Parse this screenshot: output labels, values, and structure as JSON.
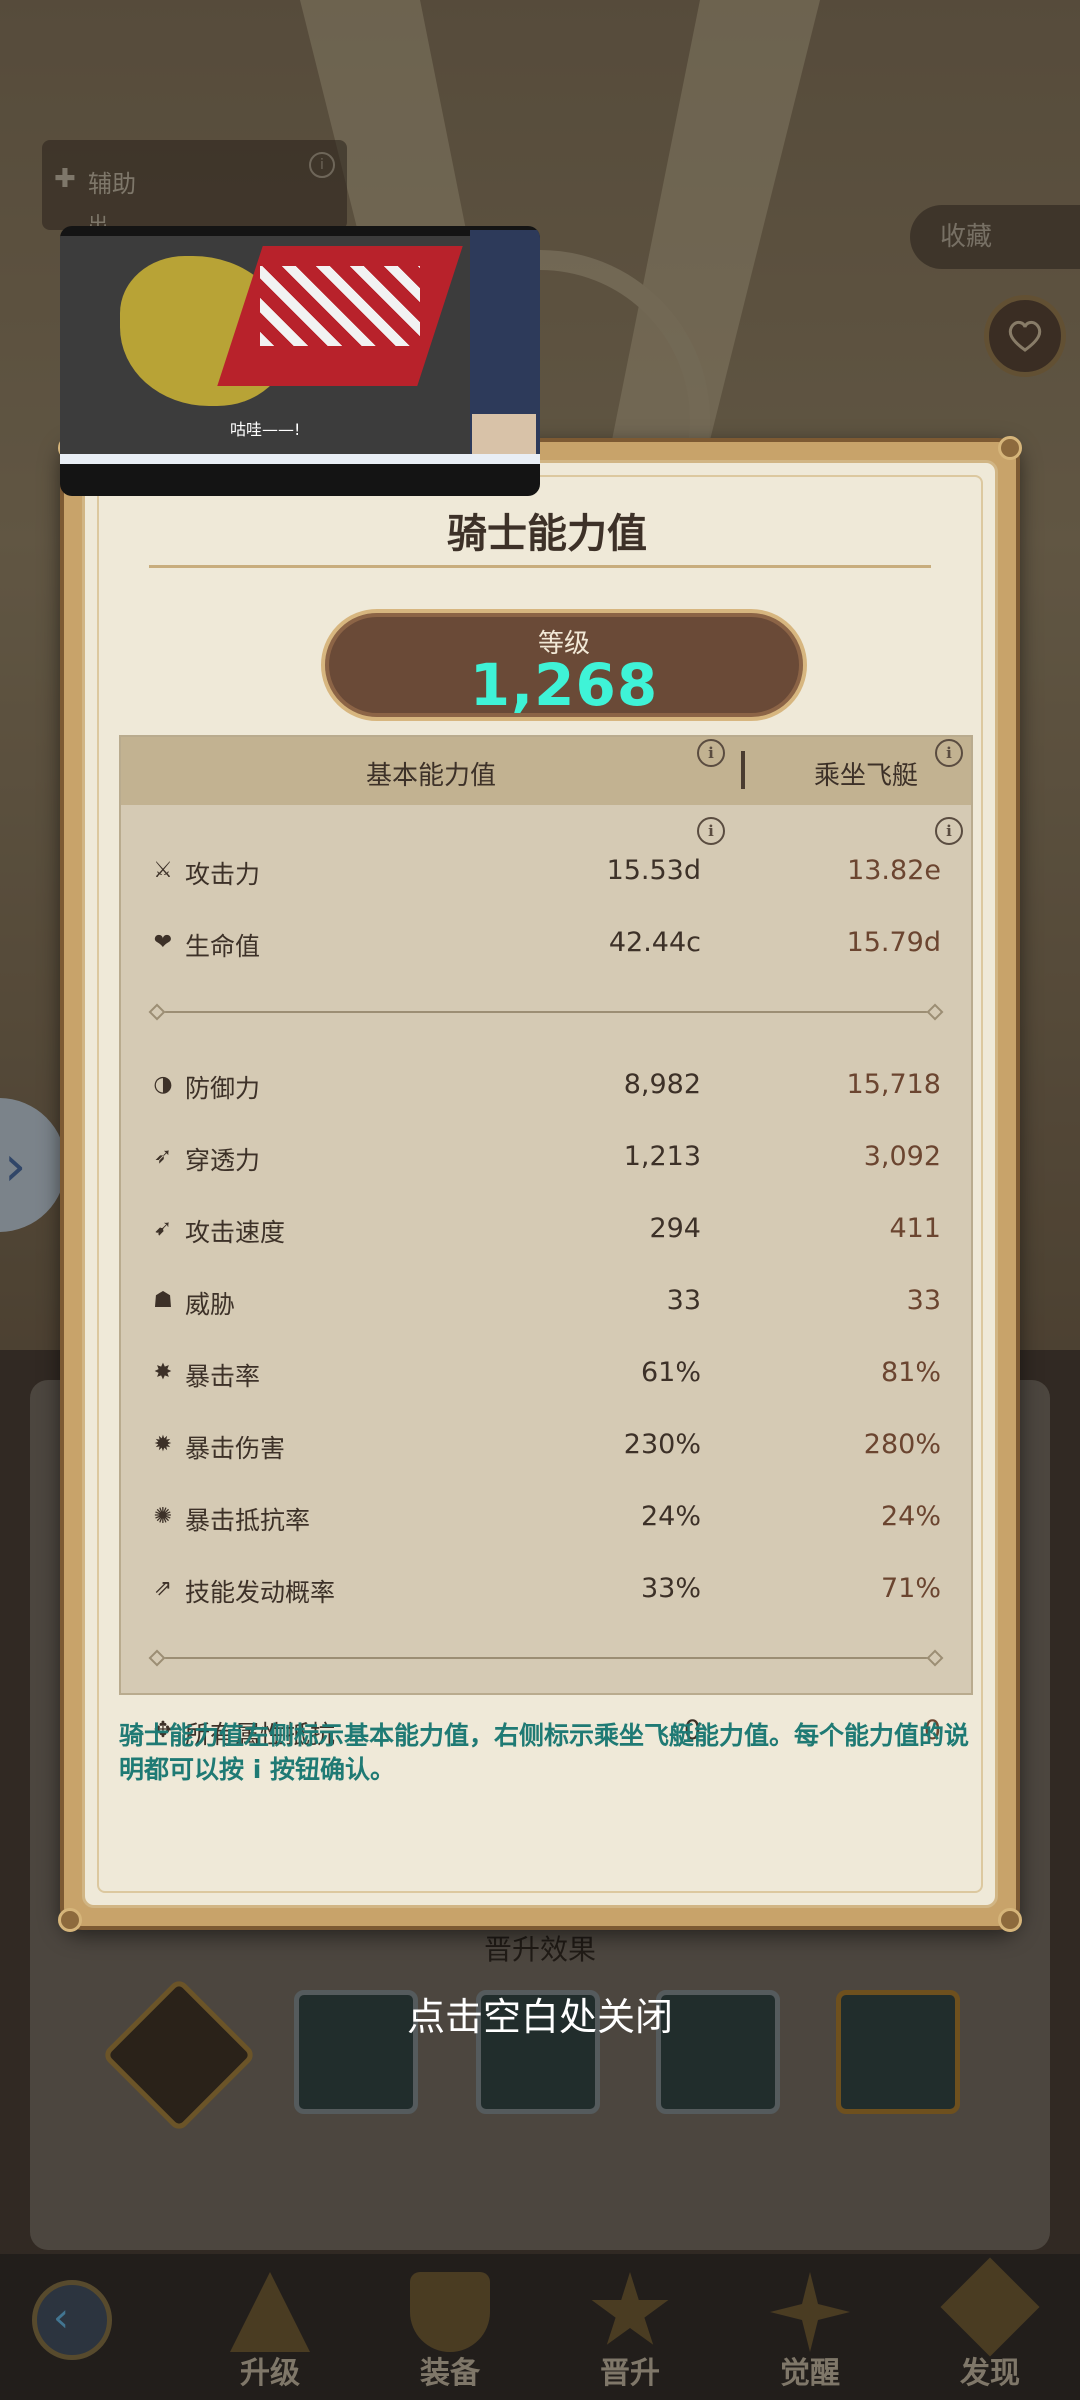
{
  "assist": {
    "label": "辅助",
    "sub": "出"
  },
  "favorites": {
    "label": "收藏"
  },
  "video": {
    "caption": "咕哇——!"
  },
  "dialog": {
    "title": "骑士能力值",
    "level_label": "等级",
    "level_value": "1,268",
    "header_basic": "基本能力值",
    "header_ship": "乘坐飞艇",
    "stats_primary": [
      {
        "icon": "sword-icon",
        "glyph": "⚔",
        "name": "攻击力",
        "basic": "15.53d",
        "ship": "13.82e"
      },
      {
        "icon": "heart-icon",
        "glyph": "❤",
        "name": "生命值",
        "basic": "42.44c",
        "ship": "15.79d"
      }
    ],
    "stats_secondary": [
      {
        "icon": "shield-icon",
        "glyph": "◑",
        "name": "防御力",
        "basic": "8,982",
        "ship": "15,718"
      },
      {
        "icon": "penetration-icon",
        "glyph": "➶",
        "name": "穿透力",
        "basic": "1,213",
        "ship": "3,092"
      },
      {
        "icon": "attack-speed-icon",
        "glyph": "➹",
        "name": "攻击速度",
        "basic": "294",
        "ship": "411"
      },
      {
        "icon": "threat-icon",
        "glyph": "☗",
        "name": "威胁",
        "basic": "33",
        "ship": "33"
      },
      {
        "icon": "crit-rate-icon",
        "glyph": "✸",
        "name": "暴击率",
        "basic": "61%",
        "ship": "81%"
      },
      {
        "icon": "crit-damage-icon",
        "glyph": "✹",
        "name": "暴击伤害",
        "basic": "230%",
        "ship": "280%"
      },
      {
        "icon": "crit-resist-icon",
        "glyph": "✺",
        "name": "暴击抵抗率",
        "basic": "24%",
        "ship": "24%"
      },
      {
        "icon": "skill-chance-icon",
        "glyph": "⇗",
        "name": "技能发动概率",
        "basic": "33%",
        "ship": "71%"
      }
    ],
    "stats_tertiary": [
      {
        "icon": "all-resist-icon",
        "glyph": "✥",
        "name": "所有属性抵抗",
        "basic": "0",
        "ship": "0"
      }
    ],
    "note": "骑士能力值左侧标示基本能力值，右侧标示乘坐飞艇能力值。每个能力值的说明都可以按 i 按钮确认。"
  },
  "promotion": {
    "title": "晋升效果"
  },
  "close_hint": "点击空白处关闭",
  "bottom_nav": [
    {
      "label": "升级",
      "icon": "upgrade-icon"
    },
    {
      "label": "装备",
      "icon": "equipment-icon"
    },
    {
      "label": "晋升",
      "icon": "promotion-icon"
    },
    {
      "label": "觉醒",
      "icon": "awaken-icon"
    },
    {
      "label": "发现",
      "icon": "discover-icon"
    }
  ],
  "colors": {
    "level": "#3ff3d7",
    "note": "#1f7a74",
    "dialog_border": "#c8a36a"
  }
}
